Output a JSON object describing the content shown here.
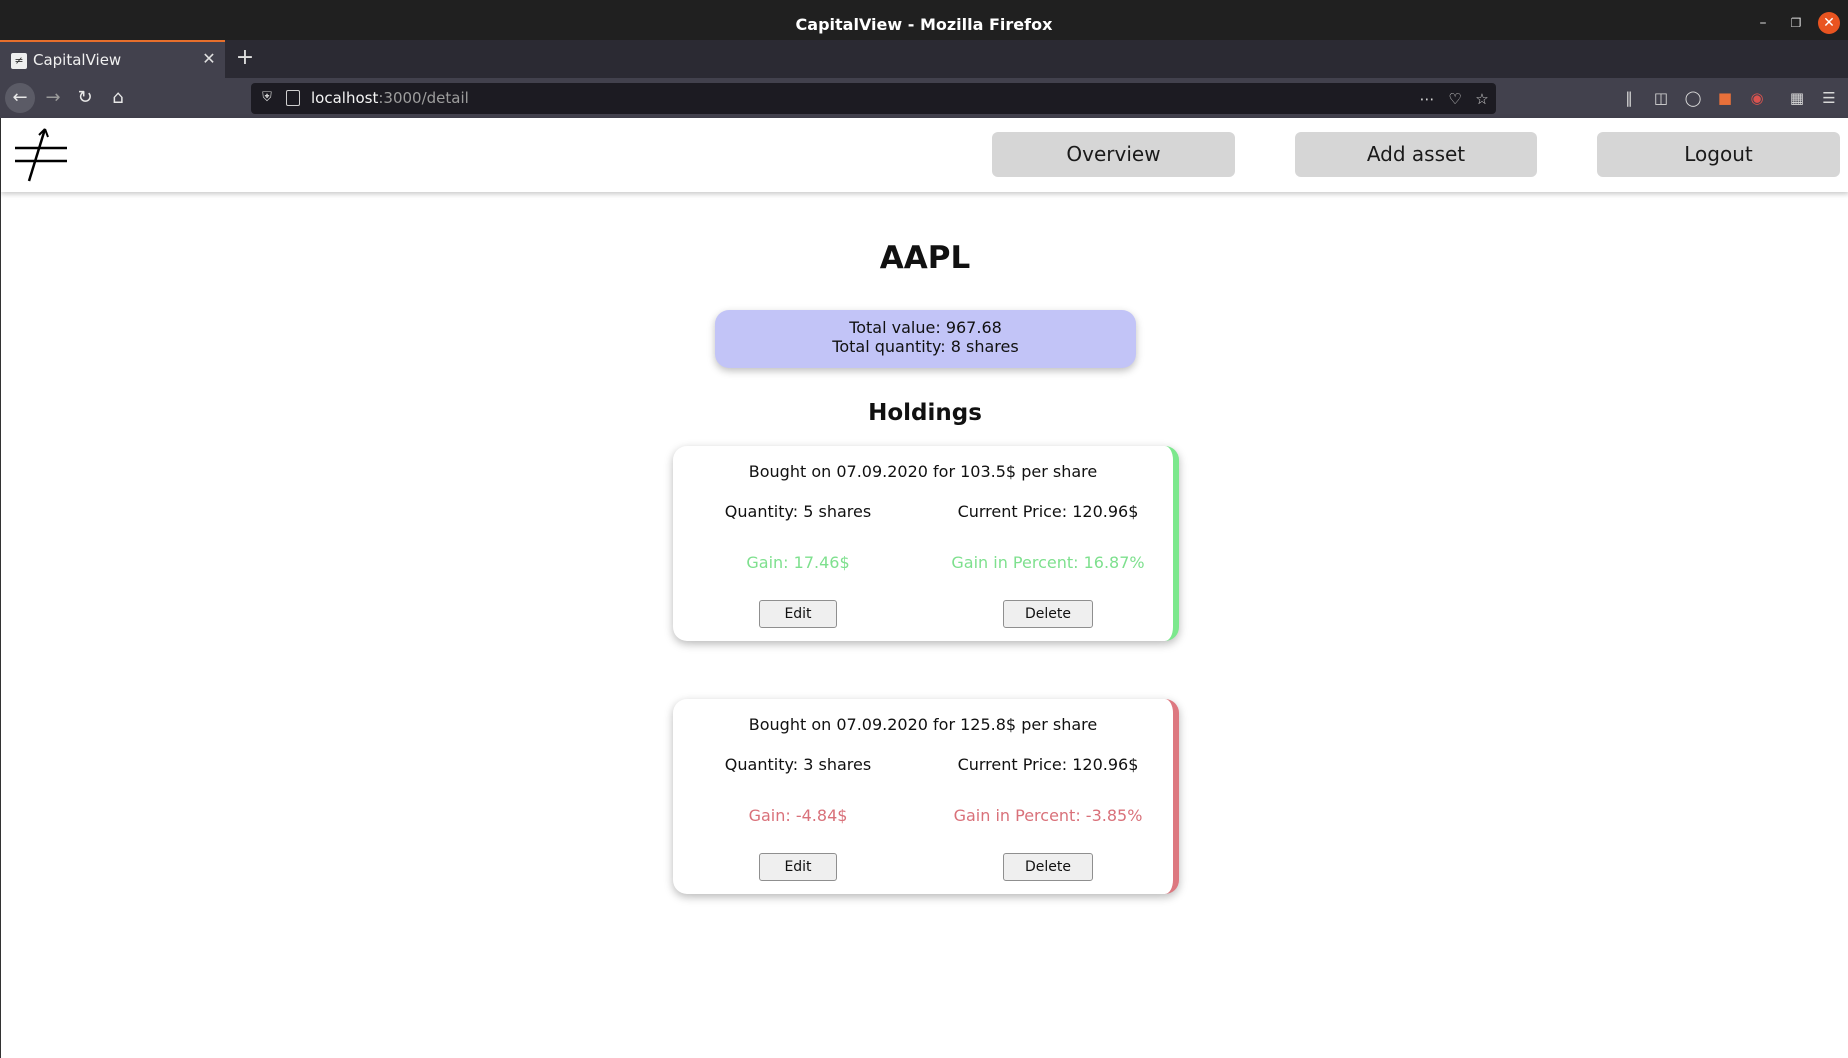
{
  "window": {
    "title": "CapitalView - Mozilla Firefox",
    "controls": [
      "minimize",
      "maximize",
      "close"
    ]
  },
  "tabs": [
    {
      "label": "CapitalView",
      "active": true
    }
  ],
  "toolbar": {
    "url_host": "localhost",
    "url_rest": ":3000/detail",
    "icons": [
      "back-icon",
      "forward-icon",
      "reload-icon",
      "home-icon",
      "shield-icon",
      "page-icon",
      "more-icon",
      "pocket-icon",
      "bookmark-star-icon",
      "library-icon",
      "sidebar-icon",
      "account-icon",
      "extension-icon",
      "extension-icon",
      "extensions-icon",
      "menu-icon"
    ]
  },
  "app": {
    "nav": {
      "overview": "Overview",
      "add_asset": "Add asset",
      "logout": "Logout"
    },
    "asset": {
      "symbol": "AAPL",
      "total_value": "Total value: 967.68",
      "total_quantity": "Total quantity: 8 shares"
    },
    "holdings_title": "Holdings",
    "holdings": [
      {
        "bought": "Bought on 07.09.2020 for 103.5$ per share",
        "quantity": "Quantity: 5 shares",
        "current_price": "Current Price: 120.96$",
        "gain": "Gain: 17.46$",
        "gain_percent": "Gain in Percent: 16.87%",
        "edit": "Edit",
        "delete": "Delete",
        "status": "positive",
        "accent": "#7ce88d"
      },
      {
        "bought": "Bought on 07.09.2020 for 125.8$ per share",
        "quantity": "Quantity: 3 shares",
        "current_price": "Current Price: 120.96$",
        "gain": "Gain: -4.84$",
        "gain_percent": "Gain in Percent: -3.85%",
        "edit": "Edit",
        "delete": "Delete",
        "status": "negative",
        "accent": "#dd7880"
      }
    ],
    "colors": {
      "summary_bg": "#c2c4f7",
      "positive": "#7ee08e",
      "negative": "#d9717a",
      "nav_button_bg": "#d6d6d6"
    }
  }
}
